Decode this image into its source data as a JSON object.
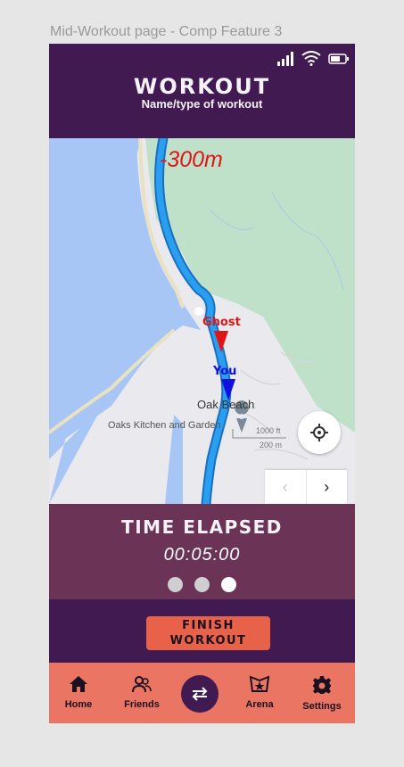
{
  "frame_label": "Mid-Workout page - Comp Feature 3",
  "header": {
    "title": "Workout",
    "subtitle": "Name/type of workout"
  },
  "map": {
    "distance": "-300m",
    "ghost_label": "Ghost",
    "you_label": "You",
    "place_oak_beach": "Oak Beach",
    "place_oaks_kitchen": "Oaks Kitchen and Garden",
    "scale_ft": "1000 ft",
    "scale_m": "200 m",
    "pager_prev": "‹",
    "pager_next": "›",
    "colors": {
      "ghost": "#e01616",
      "you": "#1010e0",
      "route": "#1a8fe0"
    }
  },
  "timer": {
    "label": "Time Elapsed",
    "value": "00:05:00",
    "pages": 3,
    "active_page": 3
  },
  "finish_button": {
    "line1": "Finish",
    "line2": "Workout"
  },
  "nav": {
    "items": [
      {
        "label": "Home",
        "icon": "home-icon"
      },
      {
        "label": "Friends",
        "icon": "friends-icon"
      },
      {
        "label": "",
        "icon": "swap-icon"
      },
      {
        "label": "Arena",
        "icon": "arena-icon"
      },
      {
        "label": "Settings",
        "icon": "gear-icon"
      }
    ]
  }
}
